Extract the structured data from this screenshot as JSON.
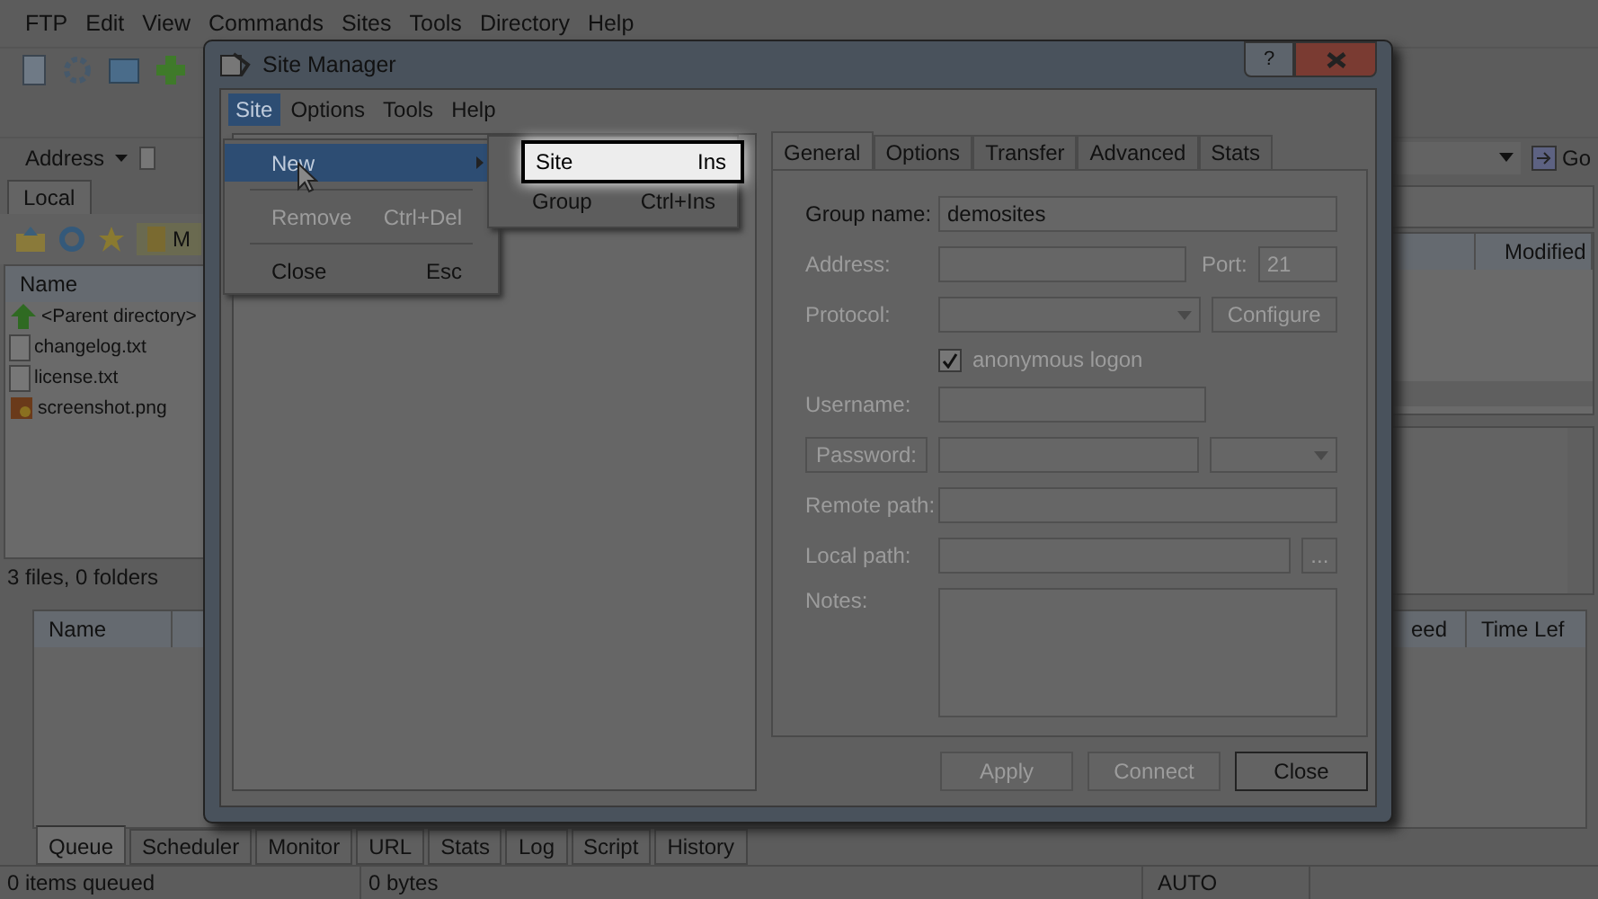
{
  "app_menu": [
    "FTP",
    "Edit",
    "View",
    "Commands",
    "Sites",
    "Tools",
    "Directory",
    "Help"
  ],
  "address": {
    "label": "Address",
    "go": "Go"
  },
  "local_panel": {
    "tab": "Local",
    "folder": "M",
    "column": "Name",
    "files": [
      {
        "name": "<Parent directory>",
        "kind": "parent"
      },
      {
        "name": "changelog.txt",
        "kind": "text"
      },
      {
        "name": "license.txt",
        "kind": "text"
      },
      {
        "name": "screenshot.png",
        "kind": "image"
      }
    ],
    "status": "3 files, 0 folders"
  },
  "remote_panel": {
    "column": "Modified"
  },
  "queue": {
    "columns": [
      "Name",
      "eed",
      "Time Lef"
    ]
  },
  "bottom_tabs": [
    {
      "label": "Queue",
      "selected": true
    },
    {
      "label": "Scheduler",
      "selected": false
    },
    {
      "label": "Monitor",
      "selected": false
    },
    {
      "label": "URL",
      "selected": false
    },
    {
      "label": "Stats",
      "selected": false
    },
    {
      "label": "Log",
      "selected": false
    },
    {
      "label": "Script",
      "selected": false
    },
    {
      "label": "History",
      "selected": false
    }
  ],
  "status_bar": [
    "0 items queued",
    "0 bytes",
    "AUTO"
  ],
  "site_manager": {
    "title": "Site Manager",
    "help": "?",
    "menu": [
      {
        "label": "Site",
        "selected": true
      },
      {
        "label": "Options",
        "selected": false
      },
      {
        "label": "Tools",
        "selected": false
      },
      {
        "label": "Help",
        "selected": false
      }
    ],
    "site_menu": [
      {
        "kind": "item",
        "label": "New",
        "selected": true,
        "disabled": false,
        "submenu": true
      },
      {
        "kind": "separator"
      },
      {
        "kind": "item",
        "label": "Remove",
        "shortcut": "Ctrl+Del",
        "selected": false,
        "disabled": true,
        "submenu": false
      },
      {
        "kind": "separator"
      },
      {
        "kind": "item",
        "label": "Close",
        "shortcut": "Esc",
        "selected": false,
        "disabled": false,
        "submenu": false
      }
    ],
    "new_submenu": [
      {
        "label": "Site",
        "shortcut": "Ins",
        "selected": true
      },
      {
        "label": "Group",
        "shortcut": "Ctrl+Ins",
        "selected": false
      }
    ],
    "tabs": [
      {
        "label": "General",
        "selected": true
      },
      {
        "label": "Options",
        "selected": false
      },
      {
        "label": "Transfer",
        "selected": false
      },
      {
        "label": "Advanced",
        "selected": false
      },
      {
        "label": "Stats",
        "selected": false
      }
    ],
    "form": {
      "group_name": {
        "label": "Group name:",
        "value": "demosites",
        "disabled": false
      },
      "address": {
        "label": "Address:",
        "disabled": true
      },
      "port": {
        "label": "Port:",
        "value": "21",
        "disabled": true
      },
      "protocol": {
        "label": "Protocol:",
        "disabled": true
      },
      "configure": {
        "label": "Configure",
        "disabled": true
      },
      "anonymous": {
        "label": "anonymous logon",
        "checked": true,
        "disabled": true
      },
      "username": {
        "label": "Username:",
        "disabled": true
      },
      "password": {
        "label": "Password:",
        "disabled": true
      },
      "remote_path": {
        "label": "Remote path:",
        "disabled": true
      },
      "local_path": {
        "label": "Local path:",
        "disabled": true
      },
      "browse": {
        "label": "...",
        "disabled": true
      },
      "notes": {
        "label": "Notes:",
        "disabled": true
      }
    },
    "buttons": [
      {
        "label": "Apply",
        "disabled": true
      },
      {
        "label": "Connect",
        "disabled": true
      },
      {
        "label": "Close",
        "disabled": false
      }
    ]
  }
}
